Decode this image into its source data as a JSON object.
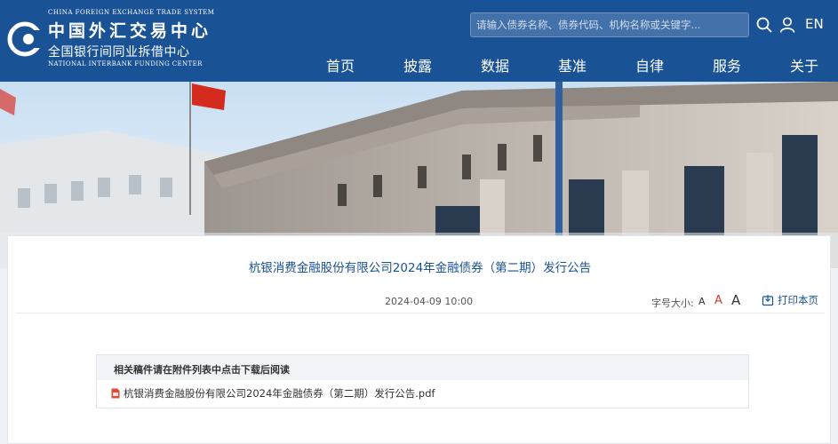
{
  "header": {
    "logo": {
      "en_top": "CHINA FOREIGN EXCHANGE TRADE SYSTEM",
      "cn_big": "中国外汇交易中心",
      "cn_small": "全国银行间同业拆借中心",
      "en_bottom": "NATIONAL INTERBANK FUNDING CENTER"
    },
    "search_placeholder": "请输入债券名称、债券代码、机构名称或关键字...",
    "lang": "EN",
    "nav": [
      "首页",
      "披露",
      "数据",
      "基准",
      "自律",
      "服务",
      "关于"
    ]
  },
  "article": {
    "title": "杭银消费金融股份有限公司2024年金融债券（第二期）发行公告",
    "date": "2024-04-09 10:00",
    "font_size_label": "字号大小:",
    "font_sizes": [
      "A",
      "A",
      "A"
    ],
    "print": "打印本页",
    "attachments_header": "相关稿件请在附件列表中点击下载后阅读",
    "attachments": [
      {
        "name": "杭银消费金融股份有限公司2024年金融债券（第二期）发行公告.pdf",
        "icon": "pdf-icon"
      }
    ]
  },
  "colors": {
    "header": "#1a5296",
    "accent": "#d23c2b"
  }
}
